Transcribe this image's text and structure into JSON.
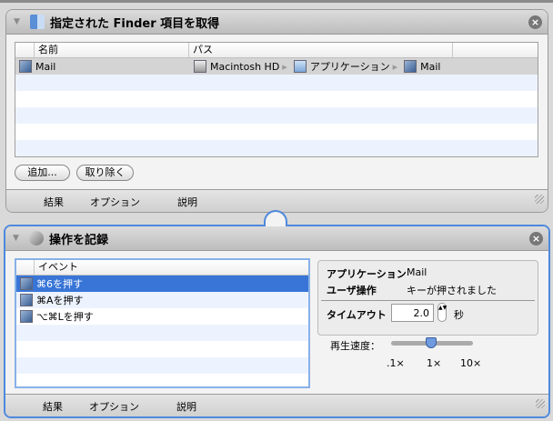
{
  "action1": {
    "title": "指定された Finder 項目を取得",
    "columns": [
      "名前",
      "パス"
    ],
    "rows": [
      {
        "name": "Mail",
        "path": [
          "Macintosh HD",
          "アプリケーション",
          "Mail"
        ]
      }
    ],
    "add_button": "追加...",
    "remove_button": "取り除く",
    "footer": [
      "結果",
      "オプション",
      "説明"
    ]
  },
  "action2": {
    "title": "操作を記録",
    "column": "イベント",
    "events": [
      "⌘6を押す",
      "⌘Aを押す",
      "⌥⌘Lを押す"
    ],
    "info": {
      "app_label": "アプリケーション",
      "app_value": "Mail",
      "op_label": "ユーザ操作",
      "op_value": "キーが押されました",
      "timeout_label": "タイムアウト",
      "timeout_value": "2.0",
      "timeout_unit": "秒"
    },
    "speed": {
      "label": "再生速度：",
      "ticks": [
        ".1×",
        "1×",
        "10×"
      ],
      "value": "1×"
    },
    "footer": [
      "結果",
      "オプション",
      "説明"
    ]
  },
  "close_glyph": "×",
  "triangle": "▼",
  "arrow": "▸",
  "accent": "#3875d7"
}
